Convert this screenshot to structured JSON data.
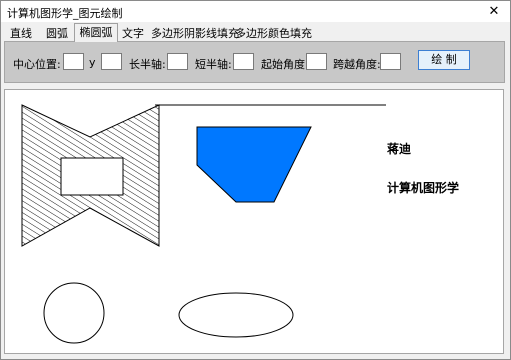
{
  "window": {
    "title": "计算机图形学_图元绘制",
    "close_label": "✕"
  },
  "tabs": [
    {
      "label": "直线",
      "active": false
    },
    {
      "label": "圆弧",
      "active": false
    },
    {
      "label": "椭圆弧",
      "active": true
    },
    {
      "label": "文字",
      "active": false
    },
    {
      "label": "多边形阴影线填充",
      "active": false
    },
    {
      "label": "多边形颜色填充",
      "active": false
    }
  ],
  "params": {
    "center_label": "中心位置: x",
    "center_x_value": "",
    "y_label": "y",
    "center_y_value": "",
    "major_axis_label": "长半轴:",
    "major_axis_value": "",
    "minor_axis_label": "短半轴:",
    "minor_axis_value": "",
    "start_angle_label": "起始角度:",
    "start_angle_value": "",
    "sweep_angle_label": "跨越角度:",
    "sweep_angle_value": "",
    "draw_button_label": "绘 制"
  },
  "canvas": {
    "author_text": "蒋迪",
    "course_text": "计算机图形学",
    "fill_color": "#0078ff",
    "stroke_color": "#000000"
  }
}
